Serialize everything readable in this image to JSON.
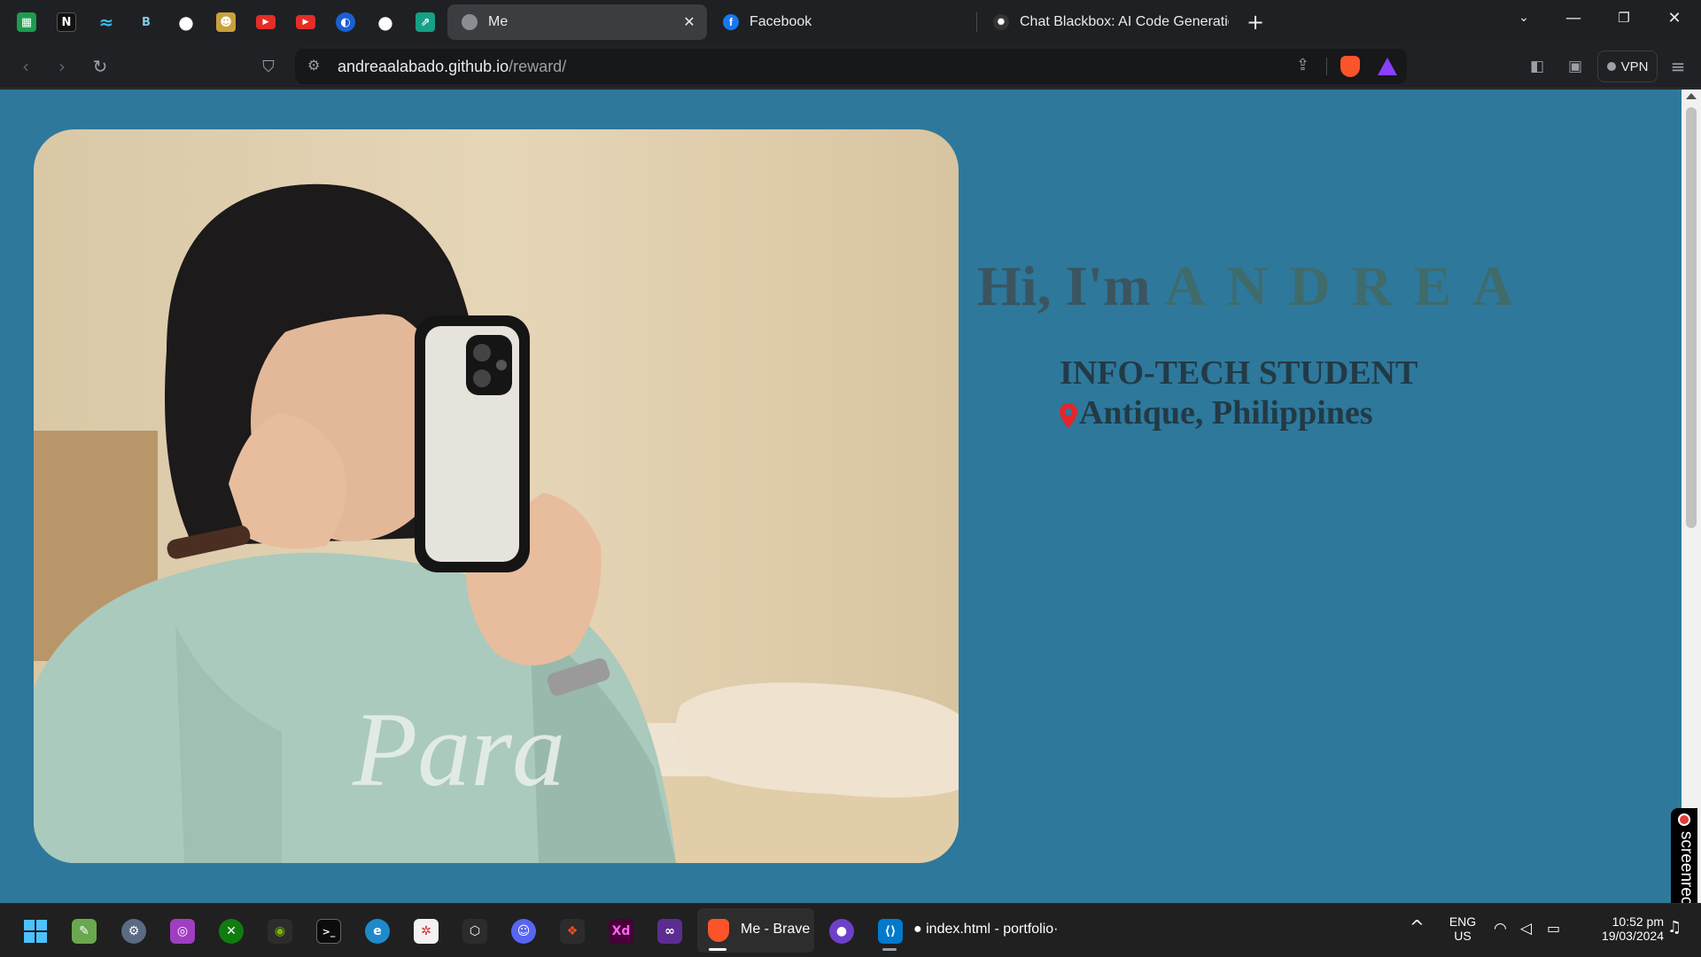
{
  "browser": {
    "pinned_tabs": [
      {
        "icon": "sheets-icon",
        "glyph": "▦",
        "color": "#1e9b4f"
      },
      {
        "icon": "notion-icon",
        "glyph": "N",
        "color": "#111111"
      },
      {
        "icon": "tailwind-icon",
        "glyph": "≈",
        "color": "#1f2023"
      },
      {
        "icon": "bootstrap-icon",
        "glyph": "B",
        "color": "#1f2023"
      },
      {
        "icon": "github-icon",
        "glyph": "●",
        "color": "#1f2023"
      },
      {
        "icon": "mascot-icon",
        "glyph": "☻",
        "color": "#c9a13c"
      },
      {
        "icon": "youtube-icon",
        "glyph": "▶",
        "color": "#e52d27"
      },
      {
        "icon": "youtube-icon",
        "glyph": "▶",
        "color": "#e52d27"
      },
      {
        "icon": "globe-icon",
        "glyph": "◐",
        "color": "#1a5fd1"
      },
      {
        "icon": "github-icon",
        "glyph": "●",
        "color": "#1f2023"
      },
      {
        "icon": "chart-icon",
        "glyph": "⇗",
        "color": "#16a085"
      }
    ],
    "tabs": [
      {
        "title": "Me",
        "favicon": "globe-icon",
        "active": true
      },
      {
        "title": "Facebook",
        "favicon": "facebook-icon",
        "active": false
      },
      {
        "title": "Chat Blackbox: AI Code Generation, C",
        "favicon": "blackbox-icon",
        "active": false
      }
    ],
    "url_host": "andreaalabado.github.io",
    "url_path": "/reward/",
    "vpn_label": "VPN"
  },
  "page": {
    "greeting": "Hi, I'm",
    "name": "ANDREA",
    "role": "INFO-TECH STUDENT",
    "location": "Antique, Philippines",
    "colors": {
      "background": "#2e789c",
      "heading": "#3a5560",
      "name": "#3f6b6b",
      "text": "#223a45",
      "pin": "#e3262d"
    }
  },
  "screenrec_label": "screenrec",
  "taskbar": {
    "apps": [
      {
        "icon": "windows-start-icon"
      },
      {
        "icon": "notepad-icon"
      },
      {
        "icon": "settings-icon"
      },
      {
        "icon": "instagram-icon"
      },
      {
        "icon": "xbox-icon"
      },
      {
        "icon": "nvidia-icon"
      },
      {
        "icon": "terminal-icon"
      },
      {
        "icon": "edge-icon"
      },
      {
        "icon": "rekordbox-icon"
      },
      {
        "icon": "unity-icon"
      },
      {
        "icon": "discord-icon"
      },
      {
        "icon": "figma-icon"
      },
      {
        "icon": "adobe-xd-icon",
        "label": "Xd"
      },
      {
        "icon": "visual-studio-icon"
      },
      {
        "icon": "brave-icon",
        "label": "Me - Brave"
      },
      {
        "icon": "github-desktop-icon"
      },
      {
        "icon": "vscode-icon",
        "label": "● index.html - portfolio·"
      }
    ],
    "tray": {
      "lang": "ENG",
      "region": "US",
      "time": "10:52 pm",
      "date": "19/03/2024"
    }
  }
}
